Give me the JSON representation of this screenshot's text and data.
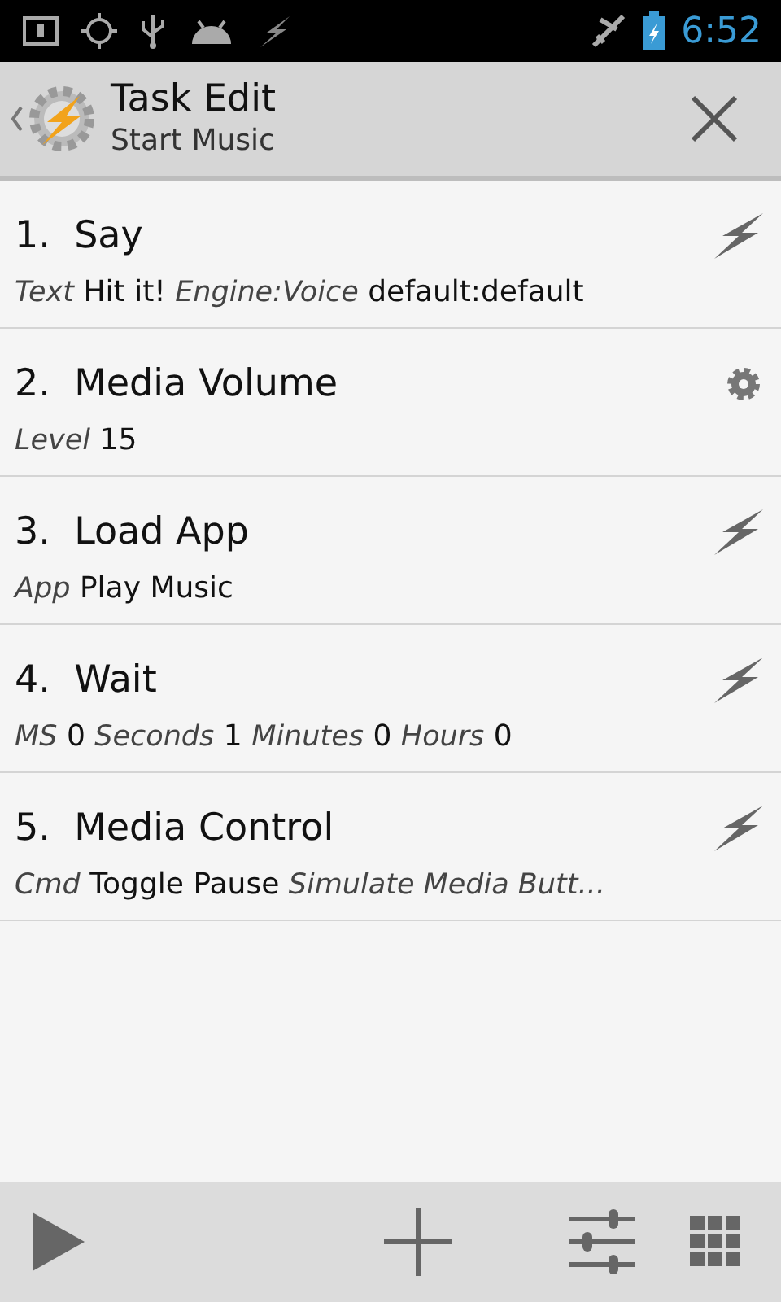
{
  "status_bar": {
    "time": "6:52"
  },
  "action_bar": {
    "title": "Task Edit",
    "subtitle": "Start Music"
  },
  "actions": [
    {
      "number": "1.",
      "name": "Say",
      "kind": "plugin",
      "params": [
        {
          "kind": "label",
          "text": "Text"
        },
        {
          "kind": "value",
          "text": "Hit it!"
        },
        {
          "kind": "label",
          "text": "Engine:Voice"
        },
        {
          "kind": "value",
          "text": "default:default"
        }
      ]
    },
    {
      "number": "2.",
      "name": "Media Volume",
      "kind": "builtin",
      "params": [
        {
          "kind": "label",
          "text": "Level"
        },
        {
          "kind": "value",
          "text": "15"
        }
      ]
    },
    {
      "number": "3.",
      "name": "Load App",
      "kind": "plugin",
      "params": [
        {
          "kind": "label",
          "text": "App"
        },
        {
          "kind": "value",
          "text": "Play Music"
        }
      ]
    },
    {
      "number": "4.",
      "name": "Wait",
      "kind": "plugin",
      "params": [
        {
          "kind": "label",
          "text": "MS"
        },
        {
          "kind": "value",
          "text": "0"
        },
        {
          "kind": "label",
          "text": "Seconds"
        },
        {
          "kind": "value",
          "text": "1"
        },
        {
          "kind": "label",
          "text": "Minutes"
        },
        {
          "kind": "value",
          "text": "0"
        },
        {
          "kind": "label",
          "text": "Hours"
        },
        {
          "kind": "value",
          "text": "0"
        }
      ]
    },
    {
      "number": "5.",
      "name": "Media Control",
      "kind": "plugin",
      "params": [
        {
          "kind": "label",
          "text": "Cmd"
        },
        {
          "kind": "value",
          "text": "Toggle Pause"
        },
        {
          "kind": "label",
          "text": "Simulate Media Butt..."
        }
      ]
    }
  ]
}
